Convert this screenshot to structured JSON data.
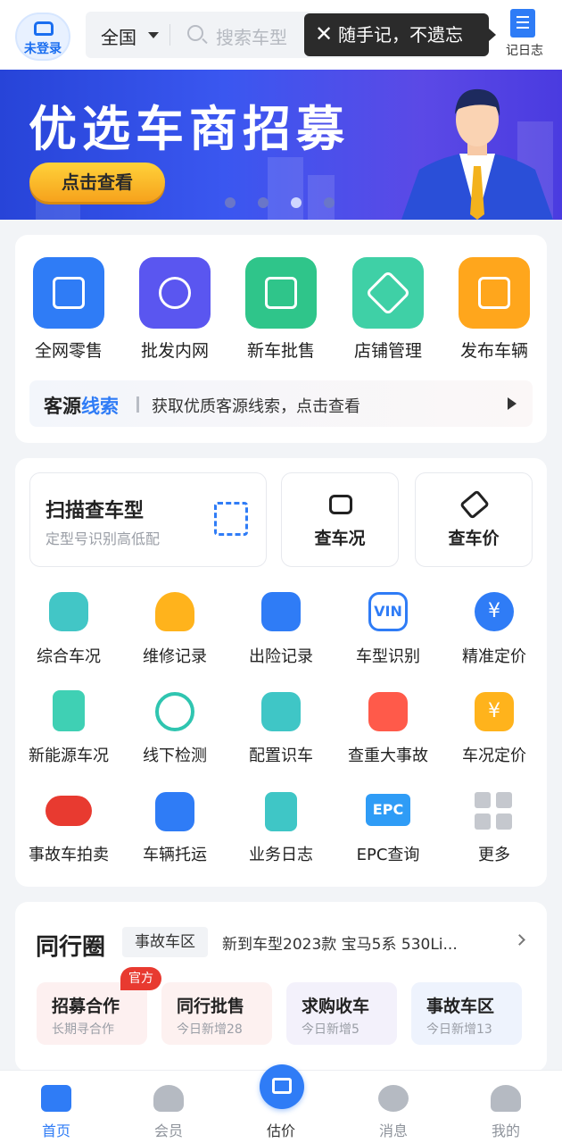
{
  "header": {
    "login_label": "未登录",
    "region": "全国",
    "search_placeholder": "搜索车型",
    "tooltip": "随手记，不遗忘",
    "diary_label": "记日志"
  },
  "banner": {
    "title": "优选车商招募",
    "button": "点击查看",
    "slide_count": 4,
    "active_slide": 3
  },
  "quick_entries": [
    {
      "label": "全网零售",
      "icon": "laptop-icon",
      "color": "#2f7cf6"
    },
    {
      "label": "批发内网",
      "icon": "globe-icon",
      "color": "#5a56f0"
    },
    {
      "label": "新车批售",
      "icon": "new-car-icon",
      "color": "#2fc58a"
    },
    {
      "label": "店铺管理",
      "icon": "store-layers-icon",
      "color": "#3fd0a6"
    },
    {
      "label": "发布车辆",
      "icon": "publish-car-icon",
      "color": "#ffa61c"
    }
  ],
  "leads": {
    "title_a": "客源",
    "title_b": "线索",
    "text": "获取优质客源线索，点击查看"
  },
  "scan": {
    "title": "扫描查车型",
    "subtitle": "定型号识别高低配"
  },
  "check_cards": [
    {
      "label": "查车况",
      "icon": "car-outline-icon"
    },
    {
      "label": "查车价",
      "icon": "price-tag-icon"
    }
  ],
  "services": [
    {
      "label": "综合车况",
      "icon": "hexagon-car-icon",
      "color": "#42c6c6"
    },
    {
      "label": "维修记录",
      "icon": "wrench-icon",
      "color": "#ffb31c"
    },
    {
      "label": "出险记录",
      "icon": "car-alert-icon",
      "color": "#2f7cf6"
    },
    {
      "label": "车型识别",
      "icon": "vin-icon",
      "color": "#2f7cf6"
    },
    {
      "label": "精准定价",
      "icon": "yen-target-icon",
      "color": "#2f7cf6"
    },
    {
      "label": "新能源车况",
      "icon": "battery-icon",
      "color": "#3fd0b4"
    },
    {
      "label": "线下检测",
      "icon": "magnifier-icon",
      "color": "#2fc5b0"
    },
    {
      "label": "配置识车",
      "icon": "car-gear-icon",
      "color": "#3fc6c6"
    },
    {
      "label": "查重大事故",
      "icon": "car-fire-icon",
      "color": "#ff5a4a"
    },
    {
      "label": "车况定价",
      "icon": "yen-hexagon-icon",
      "color": "#ffb31c"
    },
    {
      "label": "事故车拍卖",
      "icon": "auction-logo-icon",
      "color": "#e83a30"
    },
    {
      "label": "车辆托运",
      "icon": "truck-car-icon",
      "color": "#2f7cf6"
    },
    {
      "label": "业务日志",
      "icon": "note-icon",
      "color": "#3fc6c6"
    },
    {
      "label": "EPC查询",
      "icon": "epc-icon",
      "color": "#2f9cf6"
    },
    {
      "label": "更多",
      "icon": "grid-more-icon",
      "color": "#c5c8ce"
    }
  ],
  "circle": {
    "title": "同行圈",
    "tag": "事故车区",
    "news": "新到车型2023款 宝马5系 530Li...",
    "badge": "官方",
    "tiles": [
      {
        "title": "招募合作",
        "sub": "长期寻合作",
        "bg": "#fdf0f0"
      },
      {
        "title": "同行批售",
        "sub": "今日新增28",
        "bg": "#fdf1f0"
      },
      {
        "title": "求购收车",
        "sub": "今日新增5",
        "bg": "#f3f1fb"
      },
      {
        "title": "事故车区",
        "sub": "今日新增13",
        "bg": "#eef3fd"
      }
    ]
  },
  "tabbar": {
    "items": [
      {
        "label": "首页",
        "icon": "home-icon",
        "active": true
      },
      {
        "label": "会员",
        "icon": "vip-badge-icon",
        "active": false
      },
      {
        "label": "估价",
        "icon": "briefcase-icon",
        "active": false
      },
      {
        "label": "消息",
        "icon": "chat-icon",
        "active": false
      },
      {
        "label": "我的",
        "icon": "user-icon",
        "active": false
      }
    ]
  }
}
